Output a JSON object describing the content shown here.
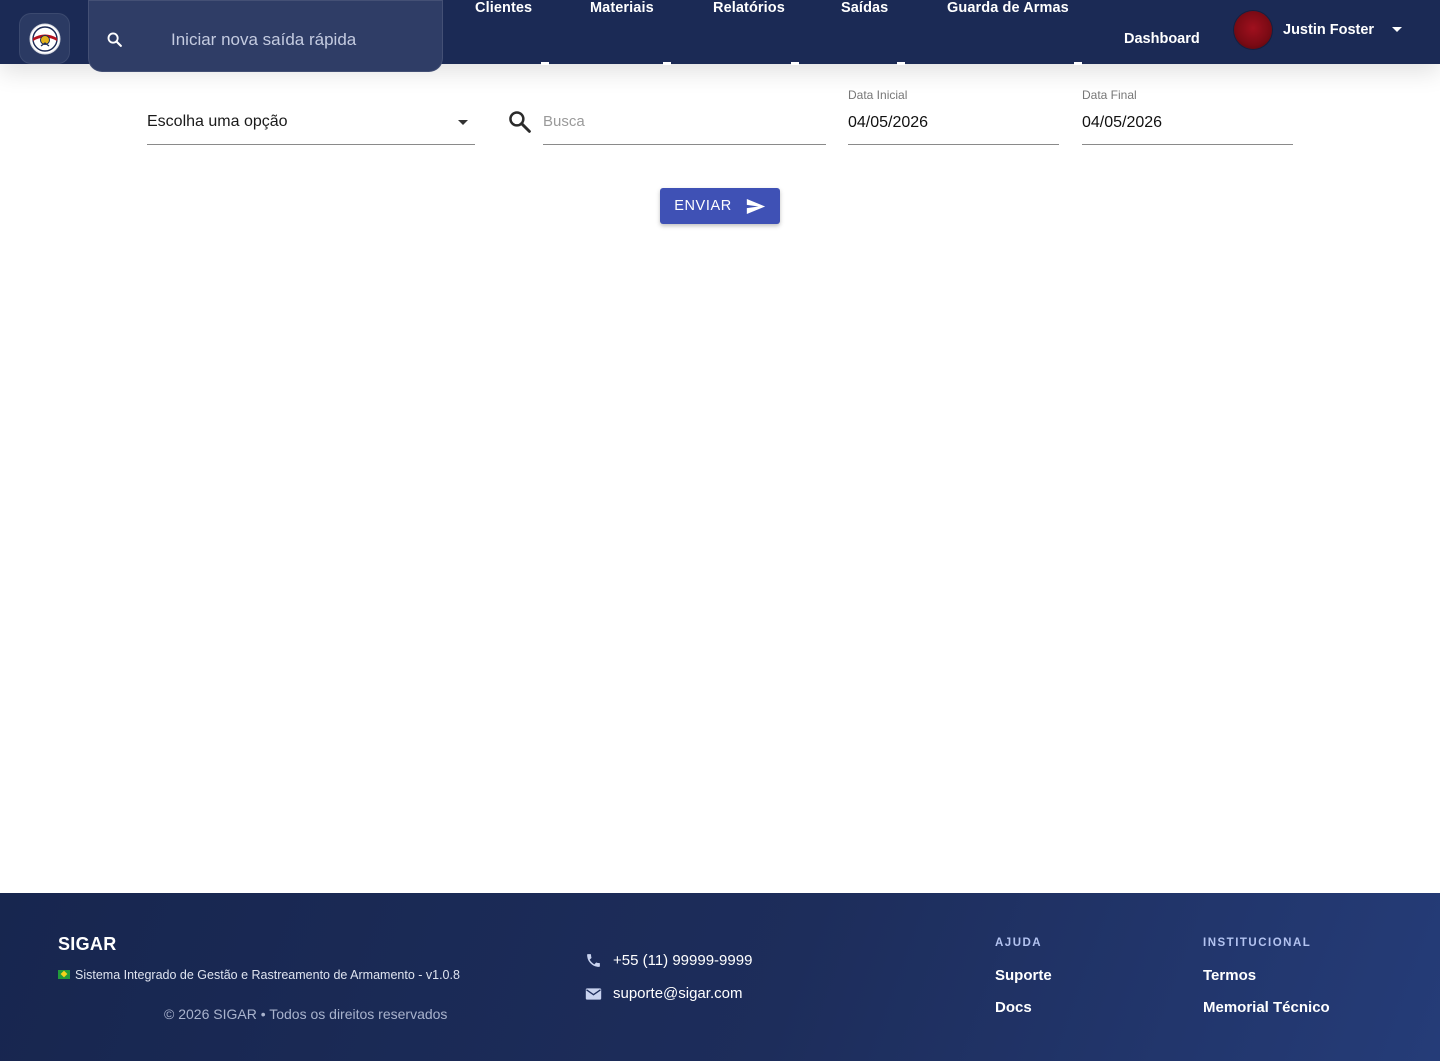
{
  "header": {
    "quick_search_placeholder": "Iniciar nova saída rápida",
    "nav": [
      "Clientes",
      "Materiais",
      "Relatórios",
      "Saídas",
      "Guarda de Armas"
    ],
    "dashboard_label": "Dashboard",
    "user_name": "Justin Foster"
  },
  "filters": {
    "select_value": "Escolha uma opção",
    "search_placeholder": "Busca",
    "start_date_label": "Data Inicial",
    "start_date_value": "04/05/2026",
    "end_date_label": "Data Final",
    "end_date_value": "04/05/2026",
    "submit_label": "ENVIAR"
  },
  "footer": {
    "brand": "SIGAR",
    "description": "Sistema Integrado de Gestão e Rastreamento de Armamento - v1.0.8",
    "copyright": "© 2026 SIGAR • Todos os direitos reservados",
    "phone": "+55 (11) 99999-9999",
    "email": "suporte@sigar.com",
    "help_title": "AJUDA",
    "help_links": [
      "Suporte",
      "Docs"
    ],
    "institutional_title": "INSTITUCIONAL",
    "institutional_links": [
      "Termos",
      "Memorial Técnico"
    ]
  },
  "colors": {
    "header_bg": "#1b2a55",
    "primary_button": "#3f51b5",
    "footer_bg": "#1d2d5b"
  }
}
